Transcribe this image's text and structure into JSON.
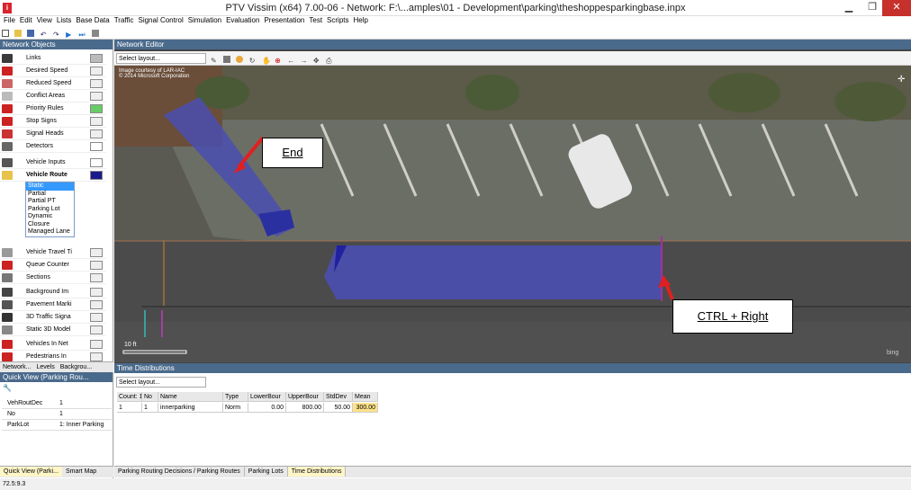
{
  "window": {
    "title": "PTV Vissim (x64) 7.00-06 - Network: F:\\...amples\\01 - Development\\parking\\theshoppesparkingbase.inpx"
  },
  "menu": [
    "File",
    "Edit",
    "View",
    "Lists",
    "Base Data",
    "Traffic",
    "Signal Control",
    "Simulation",
    "Evaluation",
    "Presentation",
    "Test",
    "Scripts",
    "Help"
  ],
  "network_objects": {
    "title": "Network Objects",
    "items": [
      {
        "label": "Links"
      },
      {
        "label": "Desired Speed"
      },
      {
        "label": "Reduced Speed"
      },
      {
        "label": "Conflict Areas"
      },
      {
        "label": "Priority Rules"
      },
      {
        "label": "Stop Signs"
      },
      {
        "label": "Signal Heads"
      },
      {
        "label": "Detectors"
      },
      {
        "label": "Vehicle Inputs"
      },
      {
        "label": "Vehicle Route"
      },
      {
        "label": "Vehicle Travel Ti"
      },
      {
        "label": "Queue Counter"
      },
      {
        "label": "Sections"
      },
      {
        "label": "Background Im"
      },
      {
        "label": "Pavement Marki"
      },
      {
        "label": "3D Traffic Signa"
      },
      {
        "label": "Static 3D Model"
      },
      {
        "label": "Vehicles In Net"
      },
      {
        "label": "Pedestrians In"
      }
    ],
    "route_types": [
      "Static",
      "Partial",
      "Partial PT",
      "Parking Lot",
      "Dynamic",
      "Closure",
      "Managed Lane"
    ],
    "tabs": [
      "Network...",
      "Levels",
      "Backgrou..."
    ]
  },
  "editor": {
    "title": "Network Editor",
    "layout_placeholder": "Select layout...",
    "credit": "Image courtesy of LAR-IAC\n© 2014 Microsoft Corporation",
    "scale": "10 ft",
    "bing": "bing",
    "annot_end": "End",
    "annot_ctrl": "CTRL + Right"
  },
  "quick_view": {
    "title": "Quick View (Parking Rou...",
    "rows": [
      {
        "key": "VehRoutDec",
        "value": "1"
      },
      {
        "key": "No",
        "value": "1"
      },
      {
        "key": "ParkLot",
        "value": "1: Inner Parking"
      }
    ],
    "tabs": [
      "Quick View (Parki...",
      "Smart Map"
    ]
  },
  "time_distributions": {
    "title": "Time Distributions",
    "layout_placeholder": "Select layout...",
    "headers": [
      "Count: 1",
      "No",
      "Name",
      "Type",
      "LowerBour",
      "UpperBour",
      "StdDev",
      "Mean"
    ],
    "row": [
      "1",
      "1",
      "innerparking",
      "Norm",
      "0.00",
      "800.00",
      "50.00",
      "300.00"
    ]
  },
  "bottom_tabs": [
    "Parking Routing Decisions / Parking Routes",
    "Parking Lots",
    "Time Distributions"
  ],
  "status": "72.5:9.3",
  "colors": {
    "route": "#4a4fb0",
    "accent": "#d9232e",
    "arrow": "#e02020"
  }
}
